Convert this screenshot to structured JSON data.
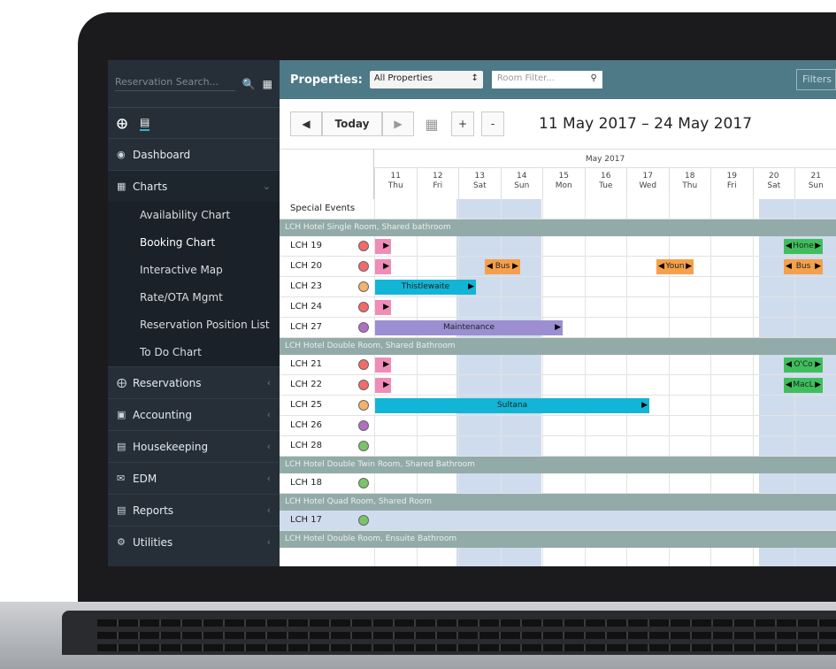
{
  "sidebar": {
    "search_placeholder": "Reservation Search...",
    "items": [
      {
        "label": "Dashboard",
        "icon": "dashboard-icon"
      },
      {
        "label": "Charts",
        "icon": "calendar-icon"
      },
      {
        "label": "Reservations",
        "icon": "plus-circle-icon"
      },
      {
        "label": "Accounting",
        "icon": "money-icon"
      },
      {
        "label": "Housekeeping",
        "icon": "bed-icon"
      },
      {
        "label": "EDM",
        "icon": "mail-icon"
      },
      {
        "label": "Reports",
        "icon": "bar-chart-icon"
      },
      {
        "label": "Utilities",
        "icon": "gear-icon"
      }
    ],
    "charts_sub": [
      "Availability Chart",
      "Booking Chart",
      "Interactive Map",
      "Rate/OTA Mgmt",
      "Reservation Position List",
      "To Do Chart"
    ]
  },
  "topbar": {
    "properties_label": "Properties:",
    "properties_value": "All Properties",
    "room_filter_placeholder": "Room Filter...",
    "filters_label": "Filters"
  },
  "toolbar": {
    "today_label": "Today",
    "plus_label": "+",
    "minus_label": "-",
    "date_range": "11 May 2017 – 24 May 2017"
  },
  "grid": {
    "month_label": "May 2017",
    "days": [
      {
        "num": "11",
        "dow": "Thu"
      },
      {
        "num": "12",
        "dow": "Fri"
      },
      {
        "num": "13",
        "dow": "Sat"
      },
      {
        "num": "14",
        "dow": "Sun"
      },
      {
        "num": "15",
        "dow": "Mon"
      },
      {
        "num": "16",
        "dow": "Tue"
      },
      {
        "num": "17",
        "dow": "Wed"
      },
      {
        "num": "18",
        "dow": "Thu"
      },
      {
        "num": "19",
        "dow": "Fri"
      },
      {
        "num": "20",
        "dow": "Sat"
      },
      {
        "num": "21",
        "dow": "Sun"
      }
    ],
    "special_events_label": "Special Events",
    "sections": [
      "LCH Hotel Single Room, Shared bathroom",
      "LCH Hotel Double Room, Shared Bathroom",
      "LCH Hotel Double Twin Room, Shared Bathroom",
      "LCH Hotel Quad Room, Shared Room",
      "LCH Hotel Double Room, Ensuite Bathroom"
    ],
    "rooms": [
      {
        "name": "LCH 19",
        "dot": "#f26b6b"
      },
      {
        "name": "LCH 20",
        "dot": "#f26b6b"
      },
      {
        "name": "LCH 23",
        "dot": "#f5b26b"
      },
      {
        "name": "LCH 24",
        "dot": "#f26b6b"
      },
      {
        "name": "LCH 27",
        "dot": "#b06fc4"
      },
      {
        "name": "LCH 21",
        "dot": "#f26b6b"
      },
      {
        "name": "LCH 22",
        "dot": "#f26b6b"
      },
      {
        "name": "LCH 25",
        "dot": "#f5b26b"
      },
      {
        "name": "LCH 26",
        "dot": "#b06fc4"
      },
      {
        "name": "LCH 28",
        "dot": "#7ac36a"
      },
      {
        "name": "LCH 18",
        "dot": "#7ac36a"
      },
      {
        "name": "LCH 17",
        "dot": "#7ac36a"
      }
    ],
    "bookings": [
      {
        "label": "Thistlewaite",
        "color": "#12b5d6"
      },
      {
        "label": "Maintenance",
        "color": "#9b8fd1"
      },
      {
        "label": "Sultana",
        "color": "#12b5d6"
      },
      {
        "label": "Bus",
        "color": "#f5a04a"
      },
      {
        "label": "Youn",
        "color": "#f5a04a"
      },
      {
        "label": "Hone",
        "color": "#3fbf5c"
      },
      {
        "label": "Bus",
        "color": "#f5a04a"
      },
      {
        "label": "O'Co",
        "color": "#3fbf5c"
      },
      {
        "label": "MacL",
        "color": "#3fbf5c"
      }
    ]
  }
}
